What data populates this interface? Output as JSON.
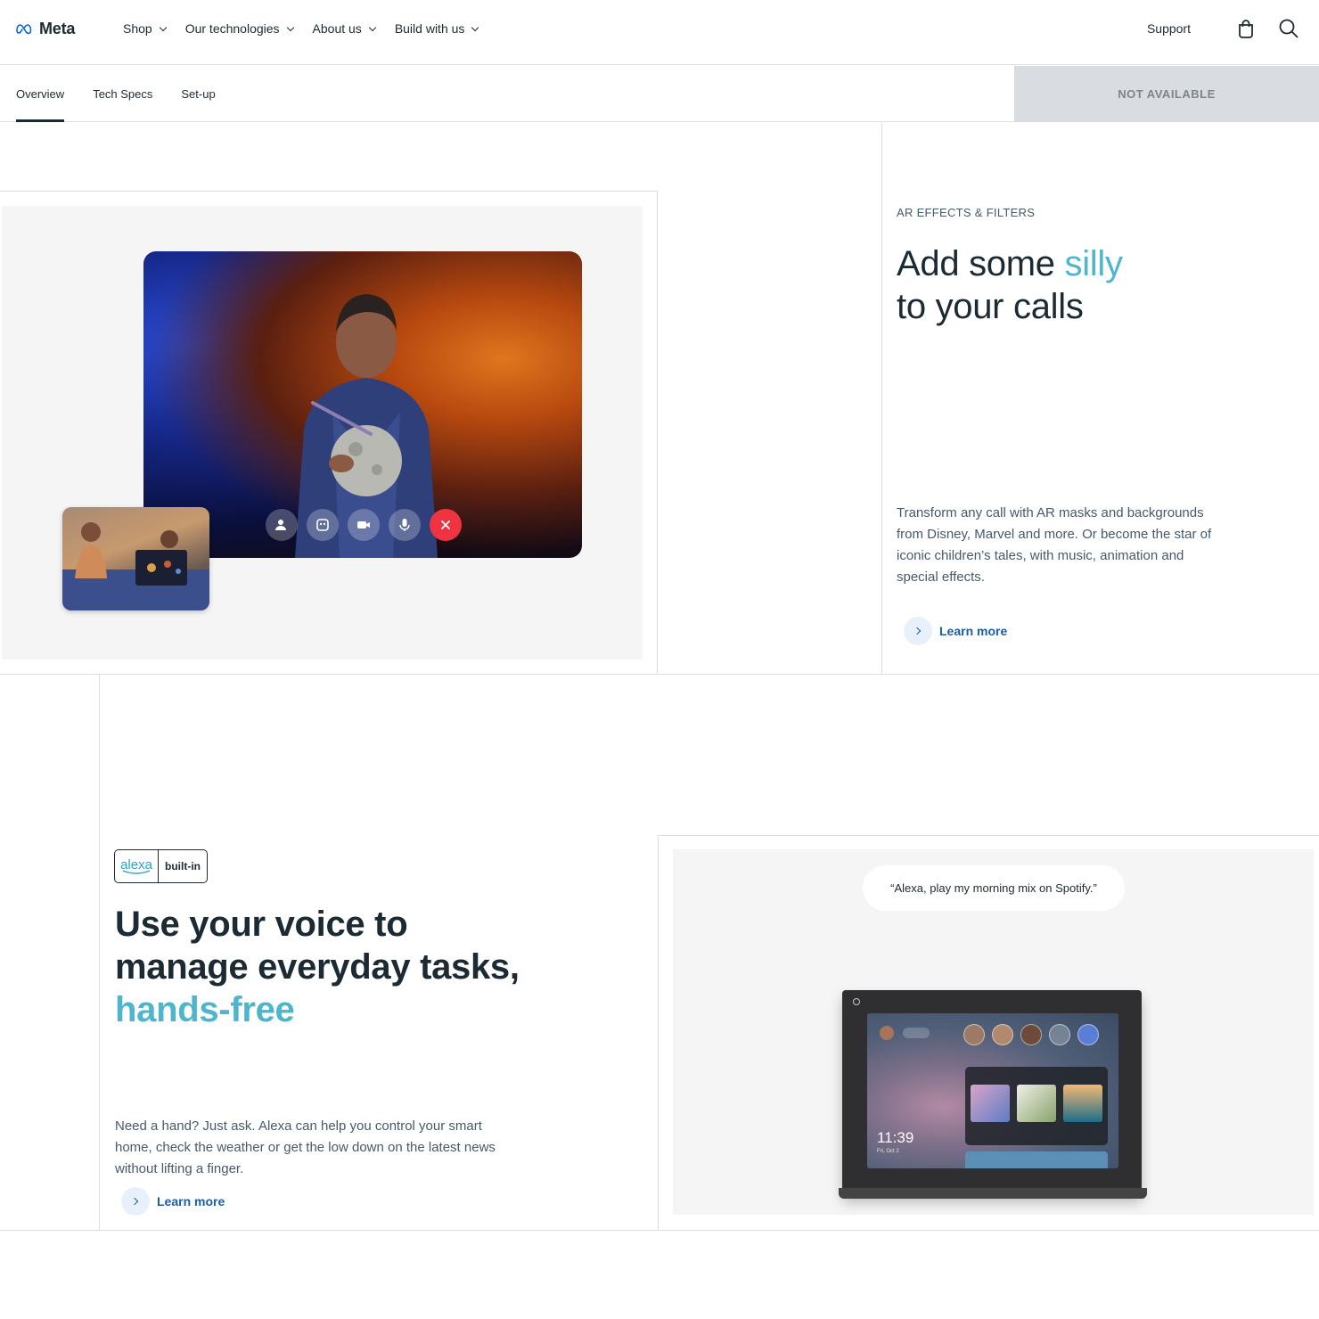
{
  "nav": {
    "brand": "Meta",
    "menu": [
      {
        "label": "Shop"
      },
      {
        "label": "Our technologies"
      },
      {
        "label": "About us"
      },
      {
        "label": "Build with us"
      }
    ],
    "support_label": "Support",
    "icons": [
      "bag-icon",
      "search-icon"
    ]
  },
  "subnav": {
    "tabs": [
      {
        "label": "Overview",
        "active": true
      },
      {
        "label": "Tech Specs",
        "active": false
      },
      {
        "label": "Set-up",
        "active": false
      }
    ],
    "status_button": "NOT AVAILABLE"
  },
  "section_ar": {
    "eyebrow": "AR EFFECTS & FILTERS",
    "title_part1": "Add some ",
    "title_accent": "silly",
    "title_part2": "to your calls",
    "body": "Transform any call with AR masks and backgrounds from Disney, Marvel and more. Or become the star of iconic children’s tales, with music, animation and special effects.",
    "learn_more": "Learn more",
    "call_controls": [
      "add-person-icon",
      "effects-icon",
      "video-icon",
      "mic-icon",
      "end-call-icon"
    ]
  },
  "section_alexa": {
    "badge_logo": "alexa",
    "badge_text": "built-in",
    "title_line1": "Use your voice to",
    "title_line2": "manage everyday tasks,",
    "title_accent": "hands-free",
    "body": "Need a hand? Just ask. Alexa can help you control your smart home, check the weather or get the low down on the latest news without lifting a finger.",
    "learn_more": "Learn more",
    "speech_bubble": "“Alexa, play my morning mix on Spotify.”",
    "device_time": "11:39",
    "device_date": "Fri, Oct 2"
  },
  "colors": {
    "accent": "#4eb6cc",
    "link": "#1b5ea8",
    "text": "#1c2b33",
    "muted": "#465a69",
    "end_call": "#ef3340",
    "not_available_bg": "#d9dde1"
  }
}
